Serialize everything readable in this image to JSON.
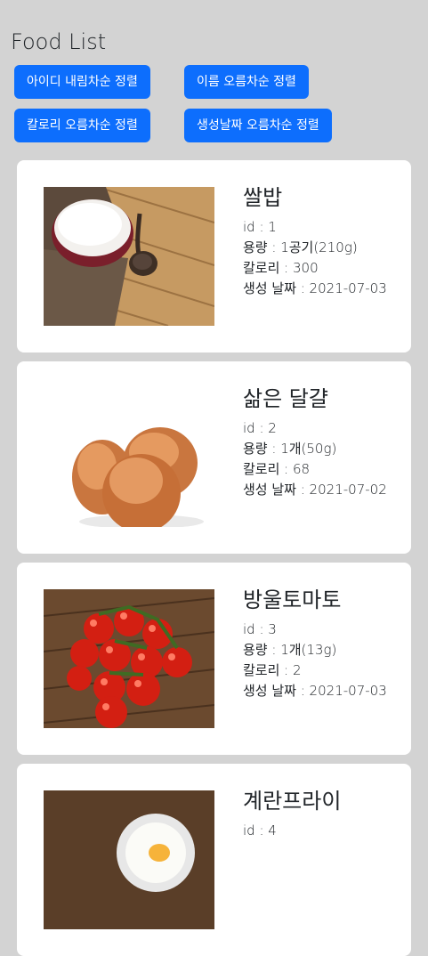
{
  "page": {
    "title": "Food List"
  },
  "sort_buttons": [
    "아이디 내림차순 정렬",
    "이름 오름차순 정렬",
    "칼로리 오름차순 정렬",
    "생성날짜 오름차순 정렬"
  ],
  "foods": [
    {
      "name": "쌀밥",
      "id": "id : 1",
      "amount": "용량 : 1공기(210g)",
      "calories": "칼로리 : 300",
      "created": "생성 날짜 : 2021-07-03",
      "image_icon": "rice-bowl-image"
    },
    {
      "name": "삶은 달걀",
      "id": "id : 2",
      "amount": "용량 : 1개(50g)",
      "calories": "칼로리 : 68",
      "created": "생성 날짜 : 2021-07-02",
      "image_icon": "boiled-eggs-image"
    },
    {
      "name": "방울토마토",
      "id": "id : 3",
      "amount": "용량 : 1개(13g)",
      "calories": "칼로리 : 2",
      "created": "생성 날짜 : 2021-07-03",
      "image_icon": "cherry-tomatoes-image"
    },
    {
      "name": "계란프라이",
      "id": "id : 4",
      "amount": "",
      "calories": "",
      "created": "",
      "image_icon": "fried-egg-image"
    }
  ]
}
